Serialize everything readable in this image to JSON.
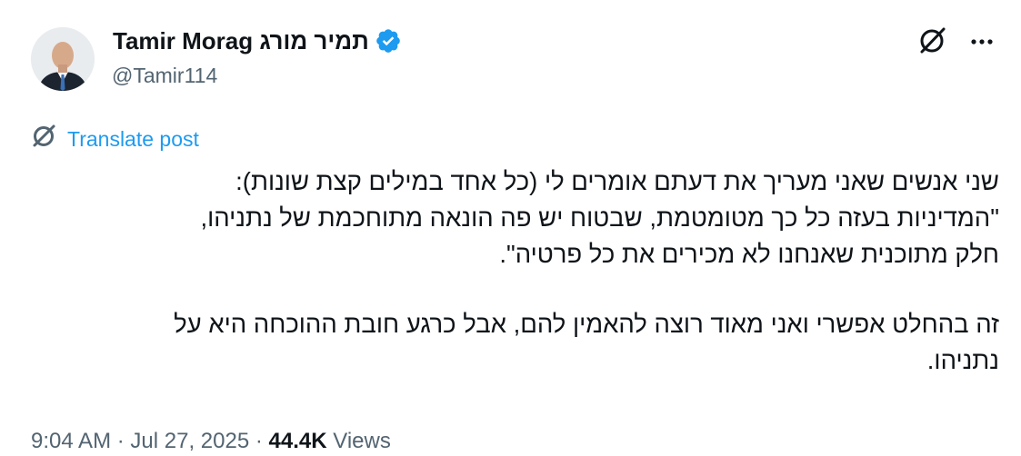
{
  "author": {
    "display_name": "Tamir Morag תמיר מורג",
    "handle": "@Tamir114",
    "verified": true
  },
  "actions": {
    "grok_icon": "grok-icon",
    "more_icon": "more-icon"
  },
  "translate": {
    "label": "Translate post"
  },
  "tweet": {
    "lines": [
      "שני אנשים שאני מעריך את דעתם אומרים לי (כל אחד במילים קצת שונות):",
      "\"המדיניות בעזה כל כך מטומטמת, שבטוח יש פה הונאה מתוחכמת של נתניהו,",
      "חלק מתוכנית שאנחנו לא מכירים את כל פרטיה\".",
      "זה בהחלט אפשרי ואני מאוד רוצה להאמין להם, אבל כרגע חובת ההוכחה היא על",
      "נתניהו."
    ]
  },
  "meta": {
    "time": "9:04 AM",
    "date": "Jul 27, 2025",
    "views_count": "44.4K",
    "views_label": "Views",
    "separator": "·"
  },
  "colors": {
    "accent": "#1d9bf0",
    "text": "#0f1419",
    "muted": "#536471"
  }
}
